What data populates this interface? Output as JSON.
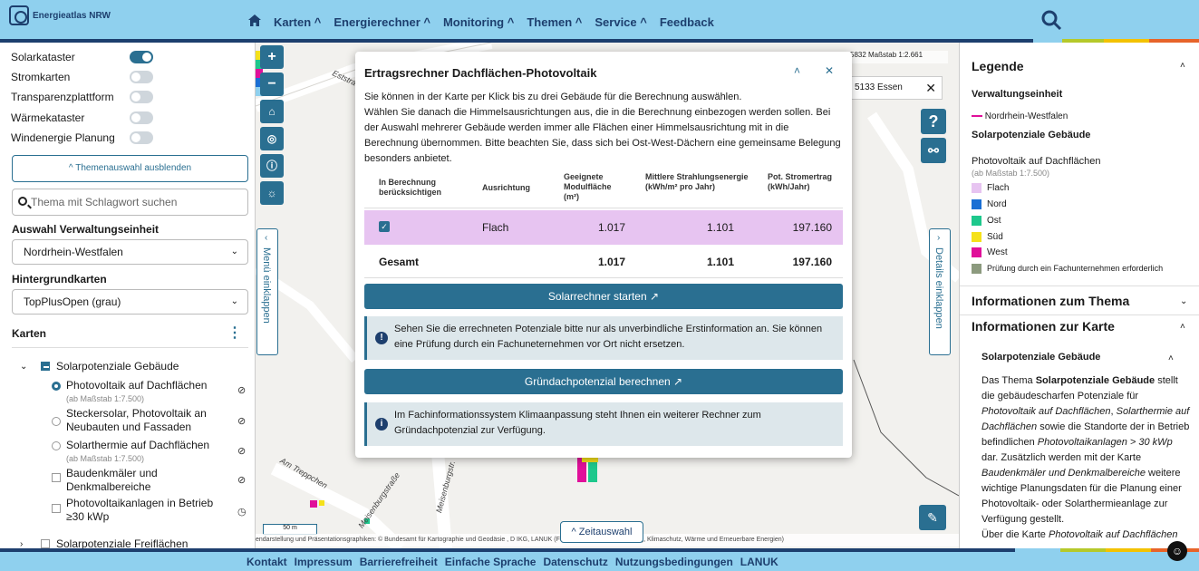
{
  "header": {
    "logo_text": "Energieatlas NRW",
    "nav": [
      "Karten ^",
      "Energierechner ^",
      "Monitoring ^",
      "Themen ^",
      "Service ^",
      "Feedback"
    ],
    "stripe_colors": [
      "#1d3f6e",
      "#8fd0ee",
      "#b5c92a",
      "#f3c200",
      "#e7642a"
    ]
  },
  "left": {
    "toggles": [
      {
        "label": "Solarkataster",
        "on": true
      },
      {
        "label": "Stromkarten",
        "on": false
      },
      {
        "label": "Transparenzplattform",
        "on": false
      },
      {
        "label": "Wärmekataster",
        "on": false
      },
      {
        "label": "Windenergie Planung",
        "on": false
      }
    ],
    "hide_themes_button": "^ Themenauswahl ausblenden",
    "search_placeholder": "Thema mit Schlagwort suchen",
    "admin_label": "Auswahl Verwaltungseinheit",
    "admin_value": "Nordrhein-Westfalen",
    "bg_label": "Hintergrundkarten",
    "bg_value": "TopPlusOpen (grau)",
    "maps_label": "Karten",
    "group_solar": "Solarpotenziale Gebäude",
    "pv_roofs": "Photovoltaik auf Dachflächen",
    "scale_note": "(ab Maßstab 1:7.500)",
    "stecker": "Steckersolar, Photovoltaik an Neubauten und Fassaden",
    "solarthermie": "Solarthermie auf Dachflächen",
    "baudenkmaeler": "Baudenkmäler und Denkmalbereiche",
    "pv_anlagen": "Photovoltaikanlagen in Betrieb ≥30 kWp",
    "group_freiflaechen": "Solarpotenziale Freiflächen"
  },
  "map": {
    "collapse_left": "Menü einklappen",
    "collapse_right": "Details einklappen",
    "coords": "5832  Maßstab  1:2.661",
    "address": "5133 Essen",
    "scale": "50 m",
    "attribution": "endarstellung und Präsentationsgraphiken: © Bundesamt für Kartographie und Geodäsie , D                             IKG, LANUK (Fachzentrum: Klimaanpassung, Klimaschutz, Wärme und Erneuerbare Energien)",
    "zeit_button": "^ Zeitauswahl",
    "street_labels": [
      "Am Treppchen",
      "Meisenburgstr.",
      "Meisenburgstraße",
      "Eststra"
    ]
  },
  "dialog": {
    "title": "Ertragsrechner Dachflächen-Photovoltaik",
    "intro1": "Sie können in der Karte per Klick bis zu drei Gebäude für die Berechnung auswählen.",
    "intro2": "Wählen Sie danach die Himmelsausrichtungen aus, die in die Berechnung einbezogen werden sollen. Bei der Auswahl mehrerer Gebäude werden immer alle Flächen einer Himmelsausrichtung mit in die Berechnung übernommen. Bitte beachten Sie, dass sich bei Ost-West-Dächern eine gemeinsame Belegung besonders anbietet.",
    "col1": "In Berechnung berücksichtigen",
    "col2": "Ausrichtung",
    "col3": "Geeignete Modulfläche (m²)",
    "col4": "Mittlere Strahlungsenergie (kWh/m² pro Jahr)",
    "col5": "Pot. Stromertrag (kWh/Jahr)",
    "row": {
      "ausrichtung": "Flach",
      "flaeche": "1.017",
      "strahlung": "1.101",
      "ertrag": "197.160"
    },
    "total": {
      "label": "Gesamt",
      "flaeche": "1.017",
      "strahlung": "1.101",
      "ertrag": "197.160"
    },
    "btn_solar": "Solarrechner starten",
    "info1": "Sehen Sie die errechneten Potenziale bitte nur als unverbindliche Erstinformation an. Sie können eine Prüfung durch ein Fachuneternehmen vor Ort nicht ersetzen.",
    "btn_gruen": "Gründachpotenzial berechnen",
    "info2": "Im Fachinformationssystem Klimaanpassung steht Ihnen ein weiterer Rechner zum Gründachpotenzial zur Verfügung."
  },
  "right": {
    "legend_title": "Legende",
    "admin_unit": "Verwaltungseinheit",
    "nrw": "Nordrhein-Westfalen",
    "solar_title": "Solarpotenziale Gebäude",
    "pv_title": "Photovoltaik auf Dachflächen",
    "scale_note": "(ab Maßstab 1:7.500)",
    "legend": [
      {
        "label": "Flach",
        "color": "#e7c4f1"
      },
      {
        "label": "Nord",
        "color": "#1a6fd4"
      },
      {
        "label": "Ost",
        "color": "#1ec88c"
      },
      {
        "label": "Süd",
        "color": "#f5e11a"
      },
      {
        "label": "West",
        "color": "#e0109a"
      },
      {
        "label": "Prüfung durch ein Fachunternehmen erforderlich",
        "color": "#8c9a7e"
      }
    ],
    "info_thema": "Informationen zum Thema",
    "info_karte": "Informationen zur Karte",
    "sub_solar": "Solarpotenziale Gebäude"
  },
  "footer": {
    "links": [
      "Kontakt",
      "Impressum",
      "Barrierefreiheit",
      "Einfache Sprache",
      "Datenschutz",
      "Nutzungsbedingungen",
      "LANUK"
    ]
  }
}
